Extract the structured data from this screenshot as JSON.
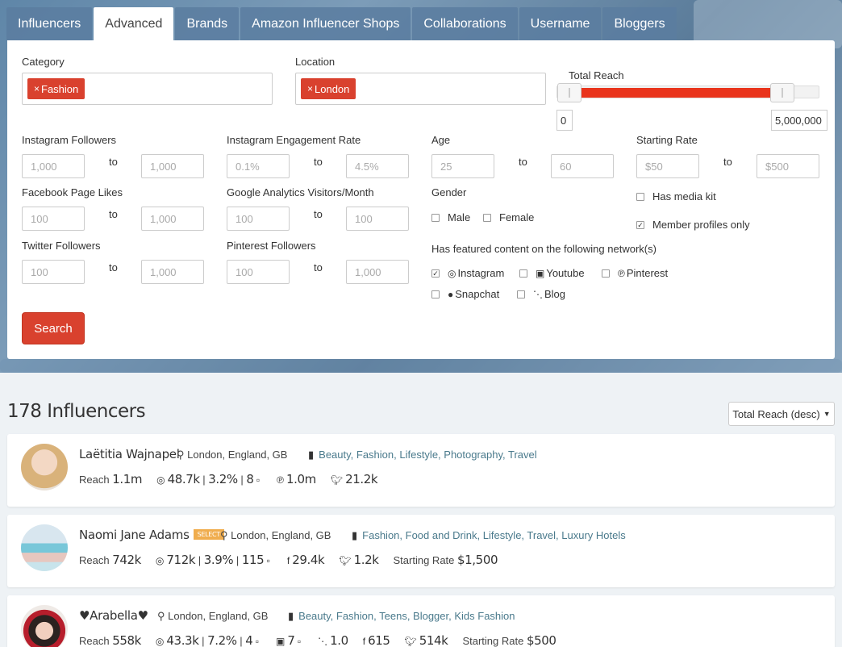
{
  "tabs": [
    "Influencers",
    "Advanced",
    "Brands",
    "Amazon Influencer Shops",
    "Collaborations",
    "Username",
    "Bloggers"
  ],
  "active_tab": "Advanced",
  "filters": {
    "category_label": "Category",
    "category_tag": "Fashion",
    "location_label": "Location",
    "location_tag": "London",
    "reach_label": "Total Reach",
    "reach_min": "0",
    "reach_max": "5,000,000",
    "reach_fill": 0.85,
    "to": "to",
    "ig_followers_label": "Instagram Followers",
    "ig_followers_min": "1,000",
    "ig_followers_max": "1,000",
    "ig_eng_label": "Instagram Engagement Rate",
    "ig_eng_min": "0.1%",
    "ig_eng_max": "4.5%",
    "age_label": "Age",
    "age_min": "25",
    "age_max": "60",
    "rate_label": "Starting Rate",
    "rate_min": "$50",
    "rate_max": "$500",
    "fb_label": "Facebook Page Likes",
    "fb_min": "100",
    "fb_max": "1,000",
    "ga_label": "Google Analytics Visitors/Month",
    "ga_min": "100",
    "ga_max": "100",
    "gender_label": "Gender",
    "male": "Male",
    "female": "Female",
    "media_kit": "Has media kit",
    "member_only": "Member profiles only",
    "tw_label": "Twitter Followers",
    "tw_min": "100",
    "tw_max": "1,000",
    "pin_label": "Pinterest Followers",
    "pin_min": "100",
    "pin_max": "1,000",
    "featured_label": "Has featured content on the following network(s)",
    "net_instagram": "Instagram",
    "net_youtube": "Youtube",
    "net_pinterest": "Pinterest",
    "net_snapchat": "Snapchat",
    "net_blog": "Blog",
    "search_button": "Search"
  },
  "results": {
    "count": "178 Influencers",
    "sort": "Total Reach (desc)"
  },
  "influencers": [
    {
      "name": "Laëtitia Wajnapel",
      "location": "London, England, GB",
      "categories": "Beauty, Fashion, Lifestyle, Photography, Travel",
      "reach_label": "Reach",
      "reach": "1.1m",
      "ig": "48.7k",
      "ig_rate": "3.2%",
      "ig_posts": "8",
      "pinterest": "1.0m",
      "twitter": "21.2k"
    },
    {
      "name": "Naomi Jane Adams",
      "badge": "SELECT",
      "location": "London, England, GB",
      "categories": "Fashion, Food and Drink, Lifestyle, Travel, Luxury Hotels",
      "reach_label": "Reach",
      "reach": "742k",
      "ig": "712k",
      "ig_rate": "3.9%",
      "ig_posts": "115",
      "facebook": "29.4k",
      "twitter": "1.2k",
      "rate_label": "Starting Rate",
      "rate": "$1,500"
    },
    {
      "name": "♥Arabella♥",
      "location": "London, England, GB",
      "categories": "Beauty, Fashion, Teens, Blogger, Kids Fashion",
      "reach_label": "Reach",
      "reach": "558k",
      "ig": "43.3k",
      "ig_rate": "7.2%",
      "ig_posts": "4",
      "youtube_posts": "7",
      "blog": "1.0",
      "facebook": "615",
      "twitter": "514k",
      "rate_label": "Starting Rate",
      "rate": "$500"
    }
  ]
}
